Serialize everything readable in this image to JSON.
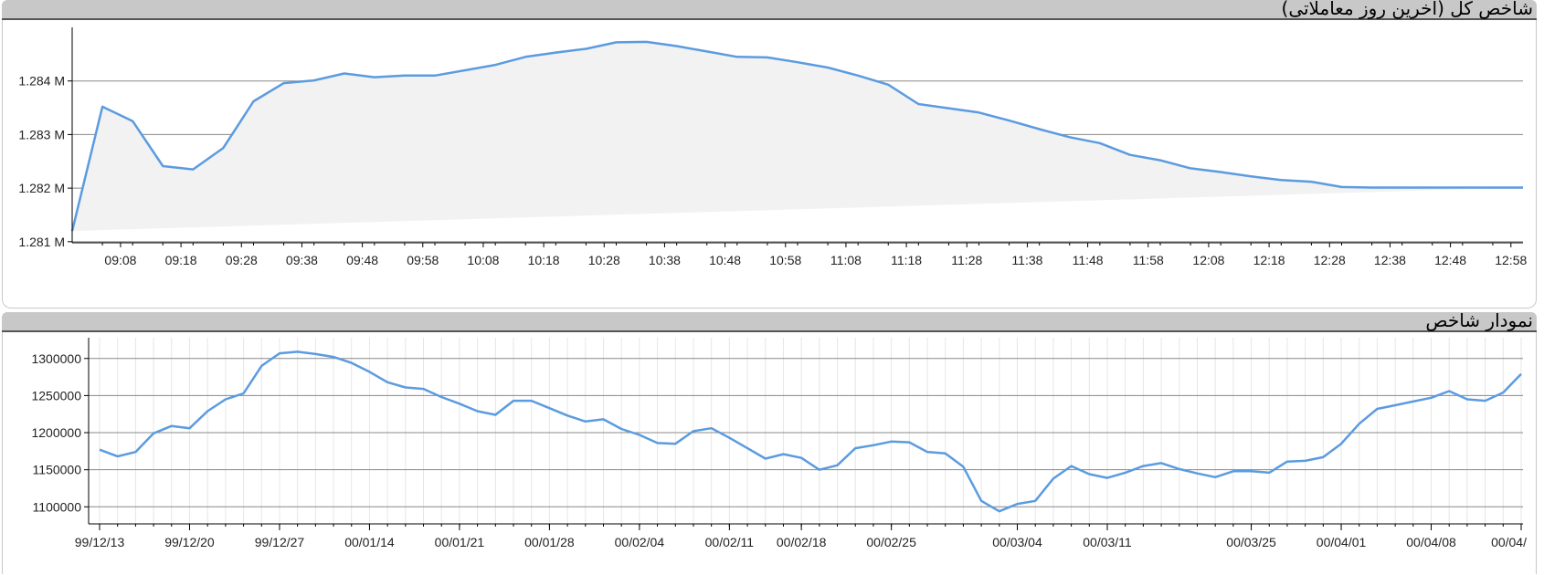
{
  "colors": {
    "line": "#5b9be0",
    "area_fill": "#f2f2f2",
    "header_bg": "#c8c8c8"
  },
  "panels": [
    {
      "title": "شاخص کل (آخرین روز معاملاتی)",
      "chart_data": {
        "type": "area",
        "title": "شاخص کل (آخرین روز معاملاتی)",
        "xlabel": "",
        "ylabel": "",
        "x_ticks": [
          "09:08",
          "09:18",
          "09:28",
          "09:38",
          "09:48",
          "09:58",
          "10:08",
          "10:18",
          "10:28",
          "10:38",
          "10:48",
          "10:58",
          "11:08",
          "11:18",
          "11:28",
          "11:38",
          "11:48",
          "11:58",
          "12:08",
          "12:18",
          "12:28",
          "12:38",
          "12:48",
          "12:58"
        ],
        "y_ticks": [
          "1.281 M",
          "1.282 M",
          "1.283 M",
          "1.284 M"
        ],
        "y_tick_values": [
          1281000,
          1282000,
          1283000,
          1284000
        ],
        "ylim": [
          1280980,
          1285000
        ],
        "xlim": [
          "09:00",
          "13:00"
        ],
        "grid": "horizontal",
        "series": [
          {
            "x": [
              "09:00",
              "09:05",
              "09:10",
              "09:15",
              "09:20",
              "09:25",
              "09:30",
              "09:35",
              "09:40",
              "09:45",
              "09:50",
              "09:55",
              "10:00",
              "10:05",
              "10:10",
              "10:15",
              "10:20",
              "10:25",
              "10:30",
              "10:35",
              "10:40",
              "10:45",
              "10:50",
              "10:55",
              "11:00",
              "11:05",
              "11:10",
              "11:15",
              "11:20",
              "11:25",
              "11:30",
              "11:35",
              "11:40",
              "11:45",
              "11:50",
              "11:55",
              "12:00",
              "12:05",
              "12:10",
              "12:15",
              "12:20",
              "12:25",
              "12:30",
              "12:35",
              "12:40",
              "12:45",
              "12:50",
              "12:55",
              "13:00"
            ],
            "values": [
              1281200,
              1283520,
              1283250,
              1282410,
              1282350,
              1282750,
              1283620,
              1283960,
              1284010,
              1284140,
              1284070,
              1284100,
              1284100,
              1284200,
              1284300,
              1284450,
              1284530,
              1284600,
              1284720,
              1284730,
              1284650,
              1284550,
              1284450,
              1284440,
              1284350,
              1284250,
              1284100,
              1283930,
              1283570,
              1283490,
              1283410,
              1283260,
              1283100,
              1282950,
              1282840,
              1282620,
              1282520,
              1282370,
              1282300,
              1282220,
              1282150,
              1282120,
              1282020,
              1282010,
              1282010,
              1282010,
              1282010,
              1282010,
              1282010
            ]
          }
        ]
      }
    },
    {
      "title": "نمودار شاخص",
      "chart_data": {
        "type": "line",
        "title": "نمودار شاخص",
        "xlabel": "",
        "ylabel": "",
        "x_ticks": [
          "99/12/13",
          "99/12/20",
          "99/12/27",
          "00/01/14",
          "00/01/21",
          "00/01/28",
          "00/02/04",
          "00/02/11",
          "00/02/18",
          "00/02/25",
          "00/03/04",
          "00/03/11",
          "00/03/25",
          "00/04/01",
          "00/04/08",
          "00/04/"
        ],
        "x_tick_index": [
          0,
          5,
          10,
          15,
          20,
          25,
          30,
          35,
          39,
          44,
          51,
          56,
          64,
          69,
          74,
          79
        ],
        "y_ticks": [
          "1100000",
          "1150000",
          "1200000",
          "1250000",
          "1300000"
        ],
        "y_tick_values": [
          1100000,
          1150000,
          1200000,
          1250000,
          1300000
        ],
        "ylim": [
          1077000,
          1328000
        ],
        "grid": "both",
        "series": [
          {
            "values": [
              1177000,
              1168000,
              1174000,
              1199000,
              1209000,
              1206000,
              1229000,
              1245000,
              1253000,
              1290000,
              1307000,
              1309000,
              1306000,
              1302000,
              1294000,
              1282000,
              1268000,
              1261000,
              1259000,
              1248000,
              1239000,
              1229000,
              1224000,
              1243000,
              1243000,
              1233000,
              1223000,
              1215000,
              1218000,
              1205000,
              1197000,
              1186000,
              1185000,
              1202000,
              1206000,
              1193000,
              1179000,
              1165000,
              1171000,
              1166000,
              1150000,
              1156000,
              1179000,
              1183000,
              1188000,
              1187000,
              1174000,
              1172000,
              1154000,
              1108000,
              1094000,
              1104000,
              1108000,
              1138000,
              1155000,
              1144000,
              1139000,
              1146000,
              1155000,
              1159000,
              1151000,
              1145000,
              1140000,
              1148000,
              1148000,
              1146000,
              1161000,
              1162000,
              1167000,
              1185000,
              1212000,
              1232000,
              1237000,
              1242000,
              1247000,
              1256000,
              1245000,
              1243000,
              1254000,
              1279000
            ]
          }
        ]
      }
    }
  ]
}
